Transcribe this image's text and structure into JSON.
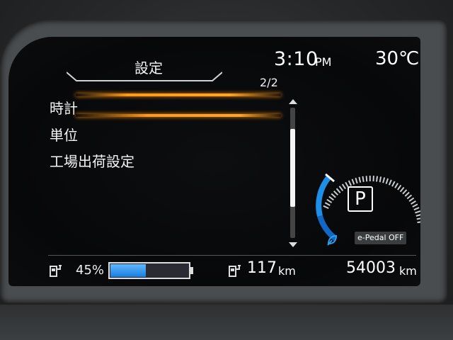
{
  "header": {
    "title": "設定",
    "time": "3:10",
    "ampm": "PM",
    "temperature": "30℃"
  },
  "menu": {
    "page_indicator": "2/2",
    "items": [
      {
        "label": "時計",
        "selected": true
      },
      {
        "label": "単位",
        "selected": false
      },
      {
        "label": "工場出荷設定",
        "selected": false
      }
    ],
    "scroll_position": 0.4
  },
  "drive": {
    "gear": "P",
    "e_pedal_label": "e-Pedal OFF"
  },
  "status": {
    "battery_percent_label": "45%",
    "battery_level": 0.45,
    "range_value": "117",
    "range_unit": "km",
    "odometer_value": "54003",
    "odometer_unit": "km"
  },
  "colors": {
    "selection": "#ffa526",
    "battery": "#1a7de0",
    "gauge": "#1e8fe8"
  }
}
